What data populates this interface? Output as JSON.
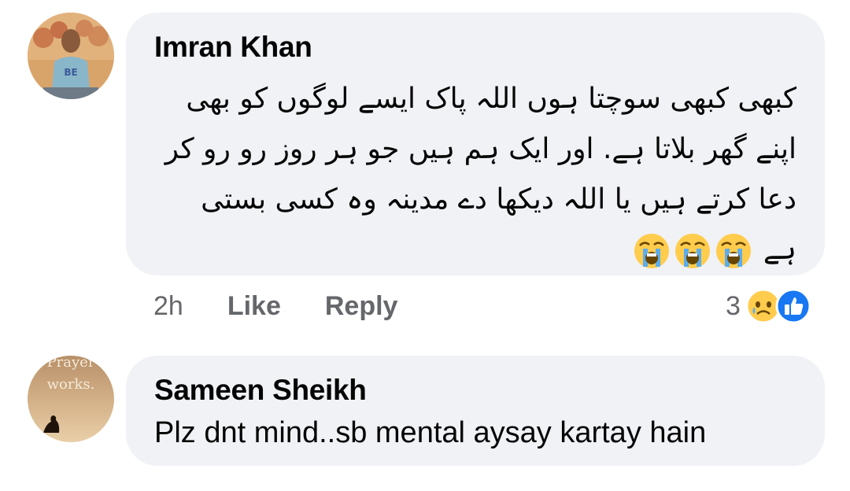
{
  "comments": [
    {
      "author": "Imran Khan",
      "avatar": "avatar-photo-man-balloons",
      "text_lines": [
        "کبھی کبھی سوچتا ہوں اللہ پاک ایسے لوگوں کو بھی",
        "اپنے گھر بلاتا ہے. اور ایک ہم ہیں جو ہر روز رو رو کر",
        "دعا کرتے ہیں یا اللہ دیکھا دے مدینہ وہ کسی بستی",
        "ہے"
      ],
      "emojis": [
        "loudly-crying-face-icon",
        "loudly-crying-face-icon",
        "loudly-crying-face-icon"
      ],
      "time": "2h",
      "like_label": "Like",
      "reply_label": "Reply",
      "reaction_count": "3",
      "reaction_icons": [
        "sad-face-icon",
        "like-thumb-icon"
      ]
    },
    {
      "author": "Sameen Sheikh",
      "avatar": "avatar-prayer-works",
      "avatar_text_1": "Prayer",
      "avatar_text_2": "works.",
      "text": "Plz dnt mind..sb mental aysay kartay hain"
    }
  ],
  "colors": {
    "bubble": "#f0f2f5",
    "meta_text": "#65676b",
    "like_blue": "#1877f2",
    "emoji_yellow": "#ffcc4d"
  }
}
